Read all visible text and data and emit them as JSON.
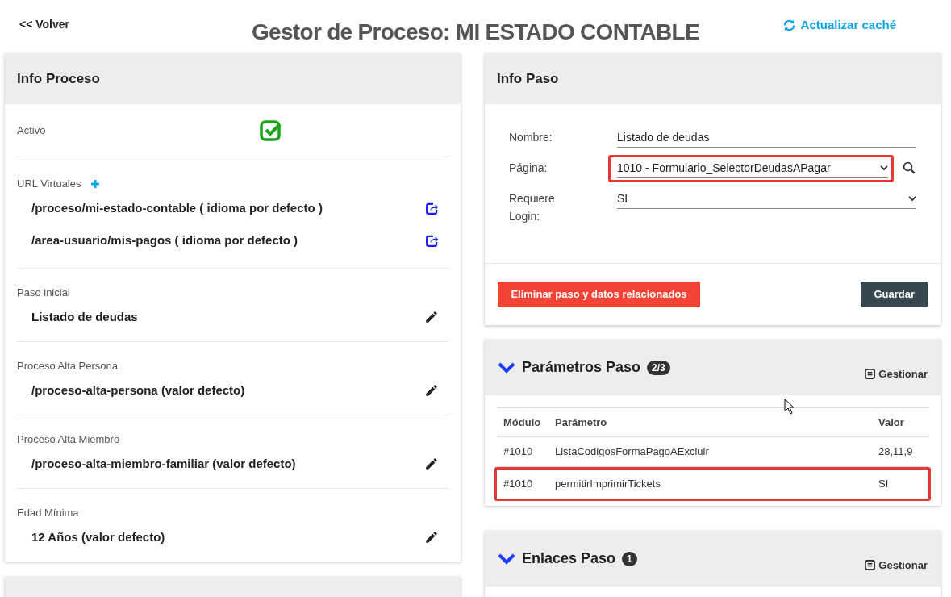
{
  "back_link": "<< Volver",
  "title": "Gestor de Proceso: MI ESTADO CONTABLE",
  "refresh_link": "Actualizar caché",
  "info_proceso": {
    "title": "Info Proceso",
    "active": {
      "label": "Activo",
      "checked": true
    },
    "urls": {
      "label": "URL Virtuales",
      "items": [
        "/proceso/mi-estado-contable ( idioma por defecto )",
        "/area-usuario/mis-pagos ( idioma por defecto )"
      ]
    },
    "fields": [
      {
        "label": "Paso inicial",
        "value": "Listado de deudas"
      },
      {
        "label": "Proceso Alta Persona",
        "value": "/proceso-alta-persona (valor defecto)"
      },
      {
        "label": "Proceso Alta Miembro",
        "value": "/proceso-alta-miembro-familiar (valor defecto)"
      },
      {
        "label": "Edad Mínima",
        "value": "12 Años (valor defecto)"
      }
    ]
  },
  "info_paso": {
    "title": "Info Paso",
    "fields": [
      {
        "kind": "text",
        "label": "Nombre:",
        "value": "Listado de deudas",
        "highlighted": false
      },
      {
        "kind": "select",
        "label": "Página:",
        "value": "1010 - Formulario_SelectorDeudasAPagar",
        "highlighted": true,
        "search": true
      },
      {
        "kind": "select",
        "label": "Requiere Login:",
        "value": "SI",
        "highlighted": false,
        "search": false
      }
    ],
    "delete_button": "Eliminar paso y datos relacionados",
    "save_button": "Guardar"
  },
  "parametros": {
    "title": "Parámetros Paso",
    "badge": "2/3",
    "expanded": true,
    "manage": "Gestionar",
    "columns": [
      "Módulo",
      "Parámetro",
      "Valor"
    ],
    "rows": [
      {
        "cells": [
          "#1010",
          "ListaCodigosFormaPagoAExcluir",
          "28,11,9"
        ],
        "highlighted": false
      },
      {
        "cells": [
          "#1010",
          "permitirImprimirTickets",
          "SI"
        ],
        "highlighted": true
      }
    ]
  },
  "enlaces": {
    "title": "Enlaces Paso",
    "badge": "1",
    "expanded": true,
    "manage": "Gestionar"
  }
}
